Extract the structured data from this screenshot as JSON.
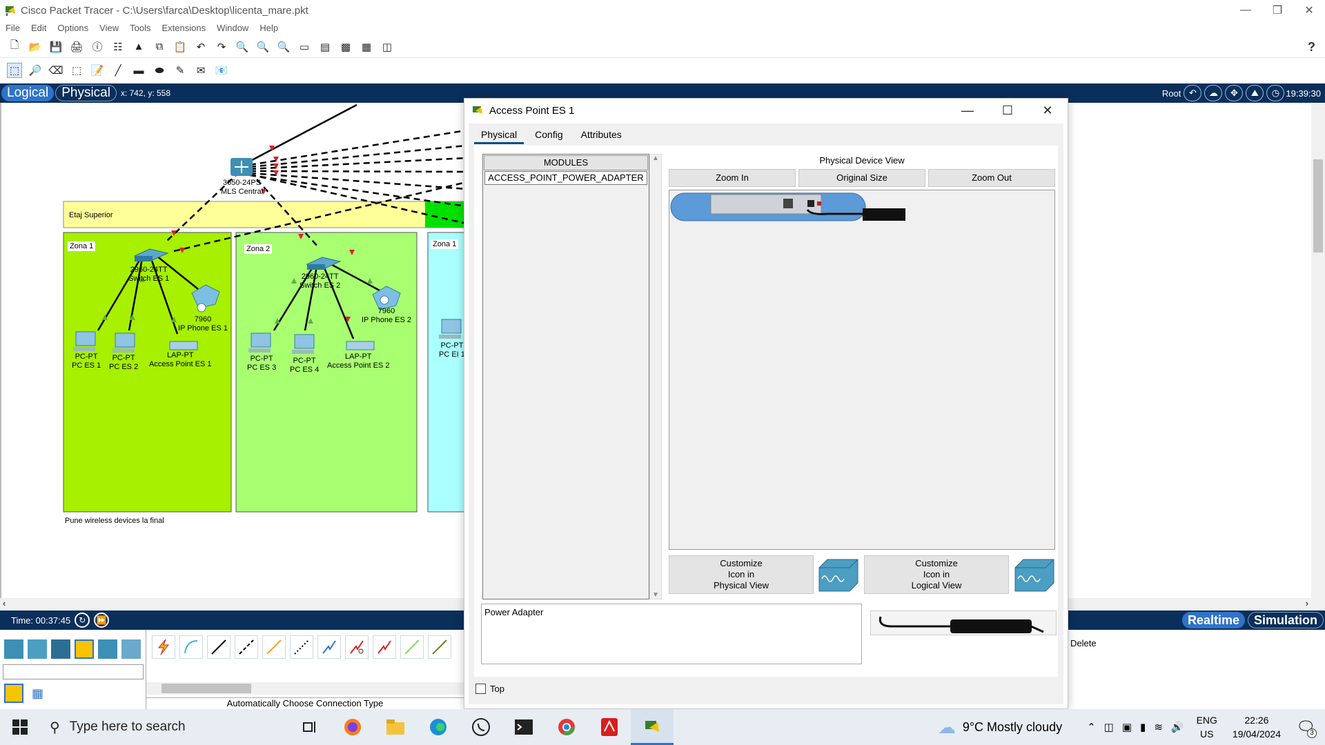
{
  "window": {
    "title": "Cisco Packet Tracer - C:\\Users\\farca\\Desktop\\licenta_mare.pkt"
  },
  "menu": [
    "File",
    "Edit",
    "Options",
    "View",
    "Tools",
    "Extensions",
    "Window",
    "Help"
  ],
  "workspace": {
    "logical_label": "Logical",
    "physical_label": "Physical",
    "coords": "x: 742, y: 558",
    "root_label": "Root",
    "clock": "19:39:30"
  },
  "topology": {
    "core_switch": [
      "3650-24PS",
      "MLS Central"
    ],
    "area_label": "Etaj Superior",
    "zone1": "Zona 1",
    "zone2": "Zona 2",
    "zone1_right": "Zona 1",
    "switch1": [
      "2960-24TT",
      "Switch ES 1"
    ],
    "switch2": [
      "2960-24TT",
      "Switch ES 2"
    ],
    "phone1": [
      "7960",
      "IP Phone ES 1"
    ],
    "phone2": [
      "7960",
      "IP Phone ES 2"
    ],
    "pc1": [
      "PC-PT",
      "PC ES 1"
    ],
    "pc2": [
      "PC-PT",
      "PC ES 2"
    ],
    "pc3": [
      "PC-PT",
      "PC ES 3"
    ],
    "pc4": [
      "PC-PT",
      "PC ES 4"
    ],
    "pc_ei": [
      "PC-PT",
      "PC EI 1"
    ],
    "ap1": [
      "LAP-PT",
      "Access Point ES 1"
    ],
    "ap2": [
      "LAP-PT",
      "Access Point ES 2"
    ],
    "note": "Pune wireless devices la final"
  },
  "sim": {
    "time": "Time: 00:37:45",
    "realtime": "Realtime",
    "simulation": "Simulation",
    "connection_caption": "Automatically Choose Connection Type",
    "right_panel_text": "Delete"
  },
  "dialog": {
    "title": "Access Point ES 1",
    "tabs": [
      "Physical",
      "Config",
      "Attributes"
    ],
    "modules_header": "MODULES",
    "modules": [
      "ACCESS_POINT_POWER_ADAPTER"
    ],
    "pdv_label": "Physical Device View",
    "zoom_in": "Zoom In",
    "original_size": "Original Size",
    "zoom_out": "Zoom Out",
    "customize_physical": "Customize\nIcon in\nPhysical View",
    "customize_logical": "Customize\nIcon in\nLogical View",
    "description": "Power Adapter",
    "top_label": "Top"
  },
  "taskbar": {
    "search_placeholder": "Type here to search",
    "weather": "9°C  Mostly cloudy",
    "lang": [
      "ENG",
      "US"
    ],
    "time": "22:26",
    "date": "19/04/2024",
    "notification_count": "3"
  },
  "colors": {
    "workspace_bar": "#0b2f5b",
    "accent_blue": "#2f73c8",
    "zone_yellow": "#ffff99",
    "zone1_green": "#a6f000",
    "zone2_green": "#a8ff70",
    "zone_cyan": "#aaffff",
    "link_red": "#e0202a"
  }
}
